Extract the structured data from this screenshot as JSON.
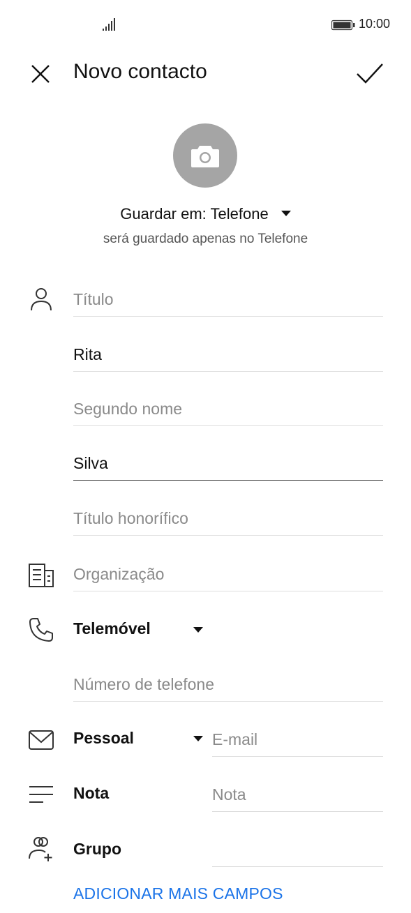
{
  "status_bar": {
    "time": "10:00"
  },
  "header": {
    "title": "Novo contacto"
  },
  "save": {
    "label": "Guardar em: Telefone",
    "subtitle": "será guardado apenas no Telefone"
  },
  "fields": {
    "title_placeholder": "Título",
    "first_name": "Rita",
    "middle_name_placeholder": "Segundo nome",
    "last_name": "Silva",
    "honorific_placeholder": "Título honorífico",
    "organization_placeholder": "Organização"
  },
  "phone": {
    "type": "Telemóvel",
    "placeholder": "Número de telefone"
  },
  "email": {
    "type": "Pessoal",
    "placeholder": "E-mail"
  },
  "note": {
    "label": "Nota",
    "placeholder": "Nota"
  },
  "group": {
    "label": "Grupo"
  },
  "add_more": "ADICIONAR MAIS CAMPOS"
}
